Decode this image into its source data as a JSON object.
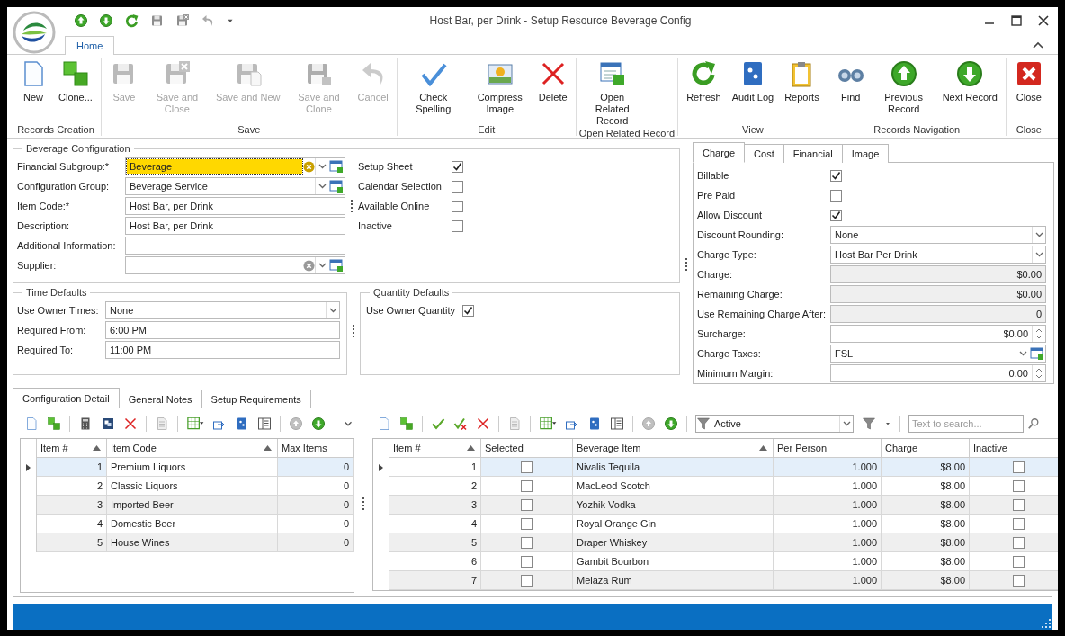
{
  "window": {
    "title": "Host Bar, per Drink - Setup Resource Beverage Config"
  },
  "ribbon": {
    "tabs": [
      {
        "label": "Home",
        "selected": true
      }
    ],
    "groups": [
      {
        "label": "Records Creation",
        "buttons": [
          {
            "label": "New",
            "disabled": false
          },
          {
            "label": "Clone...",
            "disabled": false
          }
        ]
      },
      {
        "label": "Save",
        "buttons": [
          {
            "label": "Save",
            "disabled": true
          },
          {
            "label": "Save and Close",
            "disabled": true
          },
          {
            "label": "Save and New",
            "disabled": true
          },
          {
            "label": "Save and Clone",
            "disabled": true
          },
          {
            "label": "Cancel",
            "disabled": true
          }
        ]
      },
      {
        "label": "Edit",
        "buttons": [
          {
            "label": "Check Spelling",
            "disabled": false
          },
          {
            "label": "Compress Image",
            "disabled": false
          },
          {
            "label": "Delete",
            "disabled": false
          }
        ]
      },
      {
        "label": "Open Related Record",
        "buttons": [
          {
            "label": "Open Related Record",
            "disabled": false
          }
        ]
      },
      {
        "label": "View",
        "buttons": [
          {
            "label": "Refresh",
            "disabled": false
          },
          {
            "label": "Audit Log",
            "disabled": false
          },
          {
            "label": "Reports",
            "disabled": false
          }
        ]
      },
      {
        "label": "Records Navigation",
        "buttons": [
          {
            "label": "Find",
            "disabled": false
          },
          {
            "label": "Previous Record",
            "disabled": false
          },
          {
            "label": "Next Record",
            "disabled": false
          }
        ]
      },
      {
        "label": "Close",
        "buttons": [
          {
            "label": "Close",
            "disabled": false
          }
        ]
      }
    ]
  },
  "beverage_configuration": {
    "title": "Beverage Configuration",
    "fields": [
      {
        "label": "Financial Subgroup:*",
        "value": "Beverage",
        "kind": "lookup_clearable",
        "focused": true
      },
      {
        "label": "Configuration Group:",
        "value": "Beverage Service",
        "kind": "lookup",
        "focused": false
      },
      {
        "label": "Item Code:*",
        "value": "Host Bar, per Drink",
        "kind": "text",
        "focused": false
      },
      {
        "label": "Description:",
        "value": "Host Bar, per Drink",
        "kind": "text",
        "focused": false
      },
      {
        "label": "Additional Information:",
        "kind": "text",
        "focused": false
      },
      {
        "label": "Supplier:",
        "kind": "lookup_clearable",
        "focused": false
      }
    ],
    "checkboxes": [
      {
        "label": "Setup Sheet",
        "checked": true
      },
      {
        "label": "Calendar Selection",
        "checked": false
      },
      {
        "label": "Available Online",
        "checked": false
      },
      {
        "label": "Inactive",
        "checked": false
      }
    ]
  },
  "time_defaults": {
    "title": "Time Defaults",
    "fields": [
      {
        "label": "Use Owner Times:",
        "value": "None",
        "kind": "dropdown"
      },
      {
        "label": "Required From:",
        "value": "6:00 PM",
        "kind": "text"
      },
      {
        "label": "Required To:",
        "value": "11:00 PM",
        "kind": "text"
      }
    ]
  },
  "quantity_defaults": {
    "title": "Quantity Defaults",
    "checkboxes": [
      {
        "label": "Use Owner Quantity",
        "checked": true
      }
    ]
  },
  "charge_panel": {
    "tabs": [
      {
        "label": "Charge",
        "selected": true
      },
      {
        "label": "Cost",
        "selected": false
      },
      {
        "label": "Financial",
        "selected": false
      },
      {
        "label": "Image",
        "selected": false
      }
    ],
    "rows": [
      {
        "label": "Billable",
        "kind": "checkbox",
        "checked": true
      },
      {
        "label": "Pre Paid",
        "kind": "checkbox",
        "checked": false
      },
      {
        "label": "Allow Discount",
        "kind": "checkbox",
        "checked": true
      },
      {
        "label": "Discount Rounding:",
        "kind": "dropdown",
        "value": "None"
      },
      {
        "label": "Charge Type:",
        "kind": "dropdown",
        "value": "Host Bar Per Drink"
      },
      {
        "label": "Charge:",
        "kind": "readonly",
        "value": "$0.00"
      },
      {
        "label": "Remaining Charge:",
        "kind": "readonly",
        "value": "$0.00"
      },
      {
        "label": "Use Remaining Charge After:",
        "kind": "readonly",
        "value": "0"
      },
      {
        "label": "Surcharge:",
        "kind": "spin",
        "value": "$0.00"
      },
      {
        "label": "Charge Taxes:",
        "kind": "lookup",
        "value": "FSL"
      },
      {
        "label": "Minimum Margin:",
        "kind": "spin",
        "value": "0.00"
      }
    ]
  },
  "detail_tabs": [
    {
      "label": "Configuration Detail",
      "selected": true
    },
    {
      "label": "General Notes",
      "selected": false
    },
    {
      "label": "Setup Requirements",
      "selected": false
    }
  ],
  "configuration_grid": {
    "columns": [
      {
        "label": "Item #",
        "sorted": true
      },
      {
        "label": "Item Code",
        "sorted": true
      },
      {
        "label": "Max Items",
        "sorted": false
      }
    ],
    "rows": [
      {
        "selected": true,
        "item_no": "1",
        "item_code": "Premium Liquors",
        "max_items": "0"
      },
      {
        "selected": false,
        "item_no": "2",
        "item_code": "Classic Liquors",
        "max_items": "0"
      },
      {
        "selected": false,
        "item_no": "3",
        "item_code": "Imported Beer",
        "max_items": "0"
      },
      {
        "selected": false,
        "item_no": "4",
        "item_code": "Domestic Beer",
        "max_items": "0"
      },
      {
        "selected": false,
        "item_no": "5",
        "item_code": "House Wines",
        "max_items": "0"
      }
    ]
  },
  "beverage_grid": {
    "filter": {
      "value": "Active"
    },
    "search": {
      "placeholder": "Text to search..."
    },
    "columns": [
      {
        "label": "Item #",
        "sorted": true
      },
      {
        "label": "Selected",
        "sorted": false
      },
      {
        "label": "Beverage Item",
        "sorted": true
      },
      {
        "label": "Per Person",
        "sorted": false
      },
      {
        "label": "Charge",
        "sorted": false
      },
      {
        "label": "Inactive",
        "sorted": false
      }
    ],
    "rows": [
      {
        "selected": true,
        "item_no": "1",
        "selected_check": false,
        "beverage_item": "Nivalis Tequila",
        "per_person": "1.000",
        "charge": "$8.00",
        "inactive": false
      },
      {
        "selected": false,
        "item_no": "2",
        "selected_check": false,
        "beverage_item": "MacLeod Scotch",
        "per_person": "1.000",
        "charge": "$8.00",
        "inactive": false
      },
      {
        "selected": false,
        "item_no": "3",
        "selected_check": false,
        "beverage_item": "Yozhik Vodka",
        "per_person": "1.000",
        "charge": "$8.00",
        "inactive": false
      },
      {
        "selected": false,
        "item_no": "4",
        "selected_check": false,
        "beverage_item": "Royal Orange Gin",
        "per_person": "1.000",
        "charge": "$8.00",
        "inactive": false
      },
      {
        "selected": false,
        "item_no": "5",
        "selected_check": false,
        "beverage_item": "Draper Whiskey",
        "per_person": "1.000",
        "charge": "$8.00",
        "inactive": false
      },
      {
        "selected": false,
        "item_no": "6",
        "selected_check": false,
        "beverage_item": "Gambit Bourbon",
        "per_person": "1.000",
        "charge": "$8.00",
        "inactive": false
      },
      {
        "selected": false,
        "item_no": "7",
        "selected_check": false,
        "beverage_item": "Melaza Rum",
        "per_person": "1.000",
        "charge": "$8.00",
        "inactive": false
      }
    ]
  }
}
